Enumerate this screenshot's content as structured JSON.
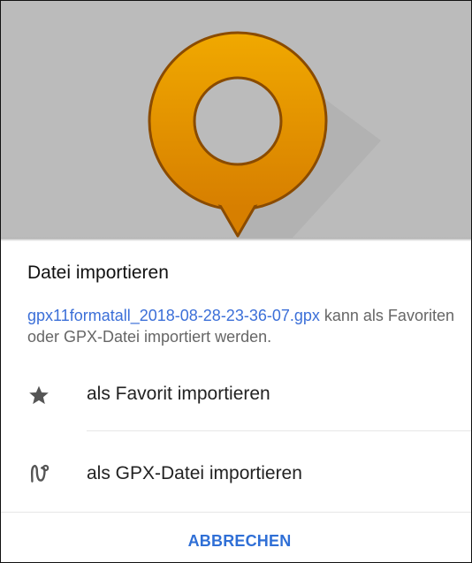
{
  "dialog": {
    "title": "Datei importieren",
    "filename": "gpx11formatall_2018-08-28-23-36-07.gpx",
    "message_suffix": " kann als Favoriten oder GPX-Datei importiert werden.",
    "options": [
      {
        "icon": "star-icon",
        "label": "als Favorit importieren"
      },
      {
        "icon": "route-icon",
        "label": "als GPX-Datei importieren"
      }
    ],
    "cancel_label": "ABBRECHEN"
  },
  "colors": {
    "accent": "#2f6fd6",
    "link": "#3b6fd8",
    "header_background": "#bbbbbb",
    "logo_orange": "#e39400",
    "logo_outline": "#8a4b00"
  },
  "header": {
    "logo_icon": "osmand-logo-icon"
  }
}
